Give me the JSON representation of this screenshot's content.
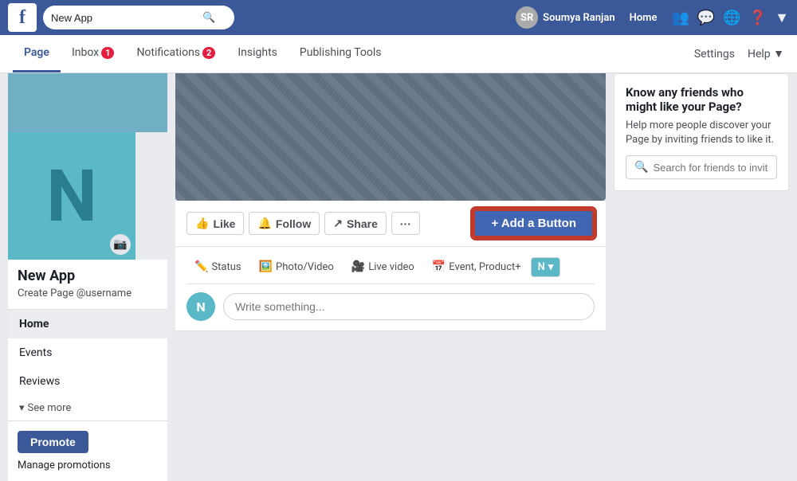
{
  "topNav": {
    "logo": "f",
    "searchPlaceholder": "New App",
    "userName": "Soumya Ranjan",
    "homeLink": "Home",
    "navIcons": [
      "friends-icon",
      "messenger-icon",
      "globe-icon",
      "help-icon",
      "dropdown-icon"
    ]
  },
  "pageNav": {
    "tabs": [
      {
        "label": "Page",
        "active": true,
        "badge": null
      },
      {
        "label": "Inbox",
        "active": false,
        "badge": "1"
      },
      {
        "label": "Notifications",
        "active": false,
        "badge": "2"
      },
      {
        "label": "Insights",
        "active": false,
        "badge": null
      },
      {
        "label": "Publishing Tools",
        "active": false,
        "badge": null
      }
    ],
    "rightLinks": [
      {
        "label": "Settings"
      },
      {
        "label": "Help ▼"
      }
    ]
  },
  "sidebar": {
    "pageName": "New App",
    "pageUsername": "Create Page @username",
    "navItems": [
      {
        "label": "Home",
        "active": true
      },
      {
        "label": "Events",
        "active": false
      },
      {
        "label": "Reviews",
        "active": false
      }
    ],
    "seeMore": "See more",
    "promoteBtn": "Promote",
    "managePromotions": "Manage promotions",
    "profileLetter": "N",
    "cameraIcon": "📷"
  },
  "actionBar": {
    "likeBtn": "Like",
    "followBtn": "Follow",
    "shareBtn": "Share",
    "moreBtn": "···",
    "addButton": "+ Add a Button"
  },
  "composer": {
    "tabs": [
      {
        "icon": "✏️",
        "label": "Status"
      },
      {
        "icon": "🖼️",
        "label": "Photo/Video"
      },
      {
        "icon": "🎥",
        "label": "Live video"
      },
      {
        "icon": "📅",
        "label": "Event, Product+"
      }
    ],
    "placeholder": "Write something...",
    "avatarLetter": "N"
  },
  "rightPanel": {
    "title": "Know any friends who might like your Page?",
    "description": "Help more people discover your Page by inviting friends to like it.",
    "searchPlaceholder": "Search for friends to invite"
  }
}
